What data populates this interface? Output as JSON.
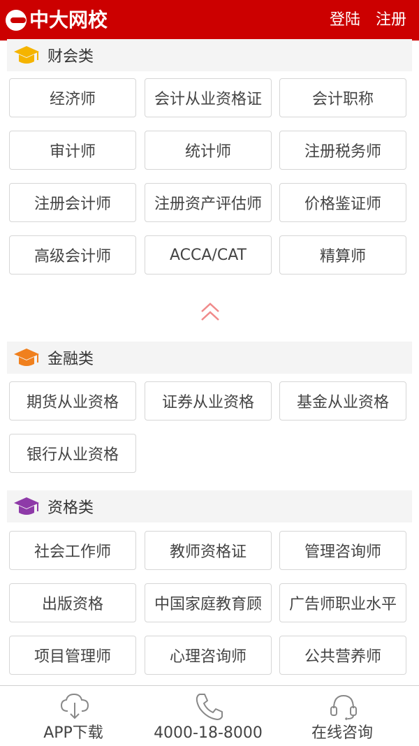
{
  "header": {
    "logo_text": "中大网校",
    "login": "登陆",
    "register": "注册",
    "brand_color": "#cc0000"
  },
  "sections": {
    "accounting": {
      "title": "财会类",
      "icon": "graduation-cap-icon",
      "icon_color": "#f5b400",
      "items": [
        "经济师",
        "会计从业资格证",
        "会计职称",
        "审计师",
        "统计师",
        "注册税务师",
        "注册会计师",
        "注册资产评估师",
        "价格鉴证师",
        "高级会计师",
        "ACCA/CAT",
        "精算师"
      ]
    },
    "finance": {
      "title": "金融类",
      "icon": "graduation-cap-icon",
      "icon_color": "#f0801e",
      "items": [
        "期货从业资格",
        "证券从业资格",
        "基金从业资格",
        "银行从业资格"
      ]
    },
    "qualification": {
      "title": "资格类",
      "icon": "graduation-cap-icon",
      "icon_color": "#8e3aa8",
      "items": [
        "社会工作师",
        "教师资格证",
        "管理咨询师",
        "出版资格",
        "中国家庭教育顾",
        "广告师职业水平",
        "项目管理师",
        "心理咨询师",
        "公共营养师"
      ]
    }
  },
  "collapse_icon": "double-chevron-up-icon",
  "bottom_bar": {
    "app": {
      "label": "APP下载",
      "icon": "cloud-download-icon"
    },
    "phone": {
      "label": "4000-18-8000",
      "icon": "phone-icon"
    },
    "consult": {
      "label": "在线咨询",
      "icon": "headset-icon"
    }
  }
}
